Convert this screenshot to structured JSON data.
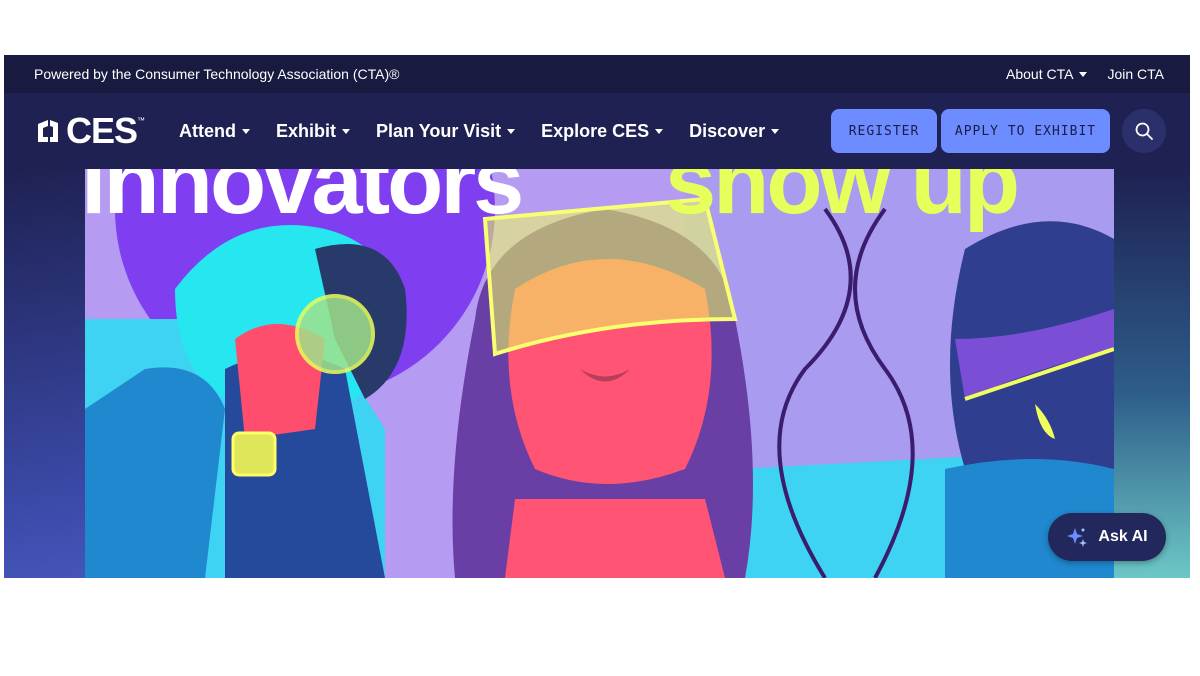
{
  "utility_bar": {
    "powered_by": "Powered by the Consumer Technology Association (CTA)®",
    "about_cta": "About CTA",
    "join_cta": "Join CTA"
  },
  "logo": {
    "text": "CES",
    "tm": "™"
  },
  "nav": {
    "items": [
      {
        "label": "Attend"
      },
      {
        "label": "Exhibit"
      },
      {
        "label": "Plan Your Visit"
      },
      {
        "label": "Explore CES"
      },
      {
        "label": "Discover"
      }
    ]
  },
  "buttons": {
    "register": "REGISTER",
    "apply": "APPLY TO EXHIBIT"
  },
  "hero": {
    "headline_part1": "innovators",
    "headline_part2": "show up"
  },
  "ask_ai": {
    "label": "Ask AI"
  },
  "colors": {
    "accent": "#6c8cff",
    "nav_bg": "#1e2152",
    "utility_bg": "#181a40",
    "headline_white": "#ffffff",
    "headline_lime": "#e6ff5a"
  },
  "icons": {
    "search": "search-icon",
    "caret": "chevron-down-icon",
    "sparkle": "sparkle-icon"
  }
}
